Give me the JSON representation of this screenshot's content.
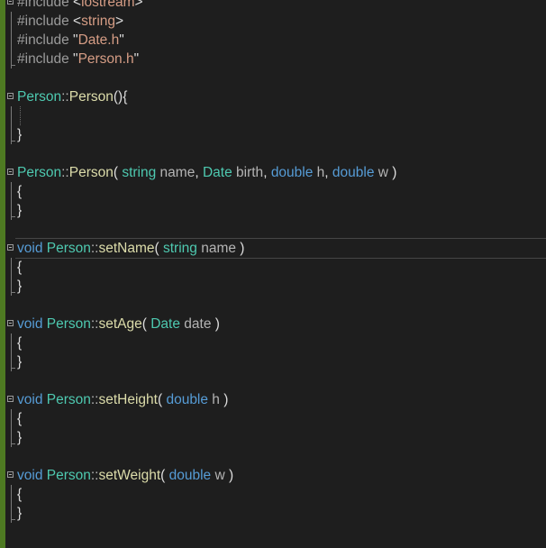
{
  "editor": {
    "lines": [
      {
        "fold": true,
        "guide": "none",
        "tokens": [
          {
            "c": "pp",
            "t": "#include "
          },
          {
            "c": "tx",
            "t": "<"
          },
          {
            "c": "str",
            "t": "iostream"
          },
          {
            "c": "tx",
            "t": ">"
          }
        ]
      },
      {
        "fold": false,
        "guide": "line",
        "tokens": [
          {
            "c": "pp",
            "t": "#include "
          },
          {
            "c": "tx",
            "t": "<"
          },
          {
            "c": "str",
            "t": "string"
          },
          {
            "c": "tx",
            "t": ">"
          }
        ]
      },
      {
        "fold": false,
        "guide": "line",
        "tokens": [
          {
            "c": "pp",
            "t": "#include "
          },
          {
            "c": "tx",
            "t": "\""
          },
          {
            "c": "str",
            "t": "Date.h"
          },
          {
            "c": "tx",
            "t": "\""
          }
        ]
      },
      {
        "fold": false,
        "guide": "end",
        "tokens": [
          {
            "c": "pp",
            "t": "#include "
          },
          {
            "c": "tx",
            "t": "\""
          },
          {
            "c": "str",
            "t": "Person.h"
          },
          {
            "c": "tx",
            "t": "\""
          }
        ]
      },
      {
        "fold": false,
        "guide": "none",
        "tokens": []
      },
      {
        "fold": true,
        "guide": "none",
        "tokens": [
          {
            "c": "ty",
            "t": "Person"
          },
          {
            "c": "op",
            "t": "::"
          },
          {
            "c": "fn",
            "t": "Person"
          },
          {
            "c": "tx",
            "t": "(){"
          }
        ]
      },
      {
        "fold": false,
        "guide": "dotted",
        "tokens": []
      },
      {
        "fold": false,
        "guide": "end",
        "tokens": [
          {
            "c": "tx",
            "t": "}"
          }
        ]
      },
      {
        "fold": false,
        "guide": "none",
        "tokens": []
      },
      {
        "fold": true,
        "guide": "none",
        "tokens": [
          {
            "c": "ty",
            "t": "Person"
          },
          {
            "c": "op",
            "t": "::"
          },
          {
            "c": "fn",
            "t": "Person"
          },
          {
            "c": "tx",
            "t": "( "
          },
          {
            "c": "ty",
            "t": "string"
          },
          {
            "c": "pm",
            "t": " name"
          },
          {
            "c": "tx",
            "t": ", "
          },
          {
            "c": "ty",
            "t": "Date"
          },
          {
            "c": "pm",
            "t": " birth"
          },
          {
            "c": "tx",
            "t": ", "
          },
          {
            "c": "kw",
            "t": "double"
          },
          {
            "c": "pm",
            "t": " h"
          },
          {
            "c": "tx",
            "t": ", "
          },
          {
            "c": "kw",
            "t": "double"
          },
          {
            "c": "pm",
            "t": " w"
          },
          {
            "c": "tx",
            "t": " )"
          }
        ]
      },
      {
        "fold": false,
        "guide": "line",
        "tokens": [
          {
            "c": "tx",
            "t": "{"
          }
        ]
      },
      {
        "fold": false,
        "guide": "end",
        "tokens": [
          {
            "c": "tx",
            "t": "}"
          }
        ]
      },
      {
        "fold": false,
        "guide": "none",
        "tokens": []
      },
      {
        "fold": true,
        "guide": "none",
        "current": true,
        "tokens": [
          {
            "c": "kw",
            "t": "void "
          },
          {
            "c": "ty",
            "t": "Person"
          },
          {
            "c": "op",
            "t": "::"
          },
          {
            "c": "fn",
            "t": "setName"
          },
          {
            "c": "tx",
            "t": "( "
          },
          {
            "c": "ty",
            "t": "string"
          },
          {
            "c": "pm",
            "t": " name"
          },
          {
            "c": "tx",
            "t": " )"
          }
        ]
      },
      {
        "fold": false,
        "guide": "line",
        "tokens": [
          {
            "c": "tx",
            "t": "{"
          }
        ]
      },
      {
        "fold": false,
        "guide": "end",
        "tokens": [
          {
            "c": "tx",
            "t": "}"
          }
        ]
      },
      {
        "fold": false,
        "guide": "none",
        "tokens": []
      },
      {
        "fold": true,
        "guide": "none",
        "tokens": [
          {
            "c": "kw",
            "t": "void "
          },
          {
            "c": "ty",
            "t": "Person"
          },
          {
            "c": "op",
            "t": "::"
          },
          {
            "c": "fn",
            "t": "setAge"
          },
          {
            "c": "tx",
            "t": "( "
          },
          {
            "c": "ty",
            "t": "Date"
          },
          {
            "c": "pm",
            "t": " date"
          },
          {
            "c": "tx",
            "t": " )"
          }
        ]
      },
      {
        "fold": false,
        "guide": "line",
        "tokens": [
          {
            "c": "tx",
            "t": "{"
          }
        ]
      },
      {
        "fold": false,
        "guide": "end",
        "tokens": [
          {
            "c": "tx",
            "t": "}"
          }
        ]
      },
      {
        "fold": false,
        "guide": "none",
        "tokens": []
      },
      {
        "fold": true,
        "guide": "none",
        "tokens": [
          {
            "c": "kw",
            "t": "void "
          },
          {
            "c": "ty",
            "t": "Person"
          },
          {
            "c": "op",
            "t": "::"
          },
          {
            "c": "fn",
            "t": "setHeight"
          },
          {
            "c": "tx",
            "t": "( "
          },
          {
            "c": "kw",
            "t": "double"
          },
          {
            "c": "pm",
            "t": " h"
          },
          {
            "c": "tx",
            "t": " )"
          }
        ]
      },
      {
        "fold": false,
        "guide": "line",
        "tokens": [
          {
            "c": "tx",
            "t": "{"
          }
        ]
      },
      {
        "fold": false,
        "guide": "end",
        "tokens": [
          {
            "c": "tx",
            "t": "}"
          }
        ]
      },
      {
        "fold": false,
        "guide": "none",
        "tokens": []
      },
      {
        "fold": true,
        "guide": "none",
        "tokens": [
          {
            "c": "kw",
            "t": "void "
          },
          {
            "c": "ty",
            "t": "Person"
          },
          {
            "c": "op",
            "t": "::"
          },
          {
            "c": "fn",
            "t": "setWeight"
          },
          {
            "c": "tx",
            "t": "( "
          },
          {
            "c": "kw",
            "t": "double"
          },
          {
            "c": "pm",
            "t": " w"
          },
          {
            "c": "tx",
            "t": " )"
          }
        ]
      },
      {
        "fold": false,
        "guide": "line",
        "tokens": [
          {
            "c": "tx",
            "t": "{"
          }
        ]
      },
      {
        "fold": false,
        "guide": "end",
        "tokens": [
          {
            "c": "tx",
            "t": "}"
          }
        ]
      },
      {
        "fold": false,
        "guide": "none",
        "tokens": []
      }
    ]
  }
}
